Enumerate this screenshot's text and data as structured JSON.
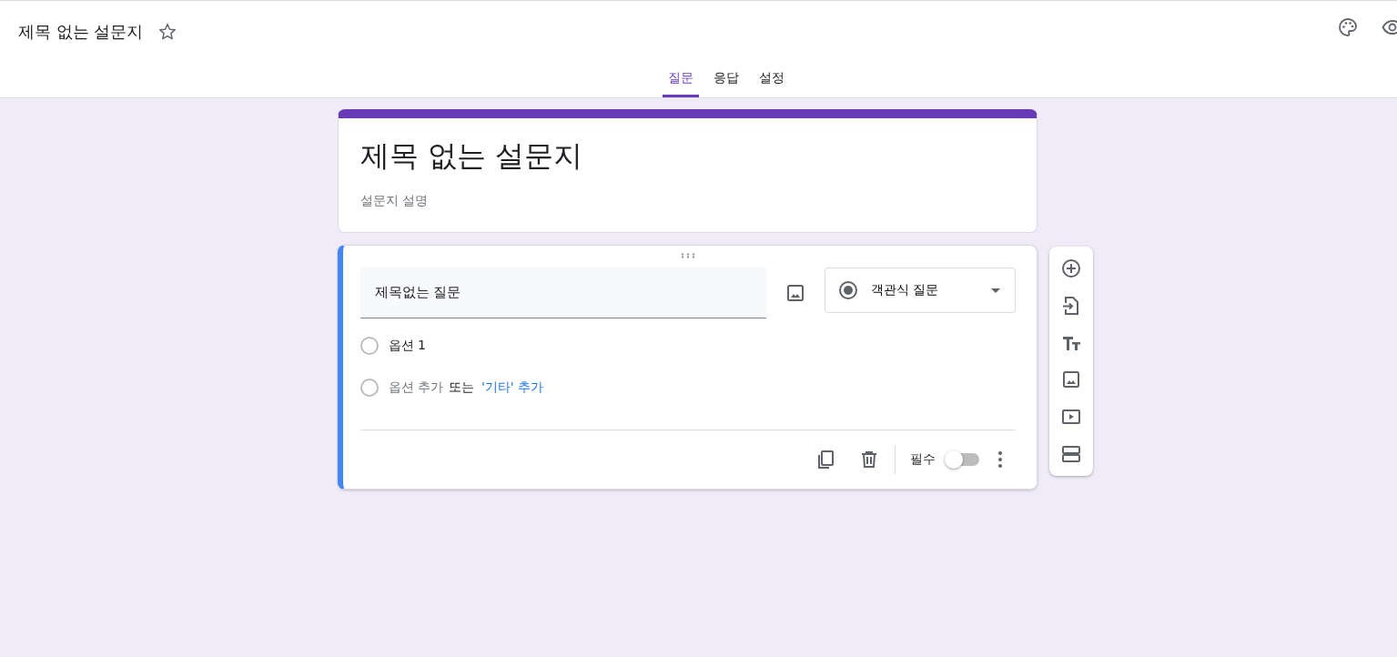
{
  "header": {
    "title": "제목 없는 설문지",
    "starred": false
  },
  "tabs": [
    {
      "label": "질문",
      "selected": true
    },
    {
      "label": "응답",
      "selected": false
    },
    {
      "label": "설정",
      "selected": false
    }
  ],
  "form_header": {
    "title": "제목 없는 설문지",
    "description_placeholder": "설문지 설명"
  },
  "question": {
    "title": "제목없는 질문",
    "type_label": "객관식 질문",
    "options": [
      {
        "label": "옵션 1"
      }
    ],
    "add_option": {
      "label": "옵션 추가",
      "separator": "또는",
      "other_link": "'기타' 추가"
    },
    "required": {
      "label": "필수",
      "on": false
    }
  }
}
